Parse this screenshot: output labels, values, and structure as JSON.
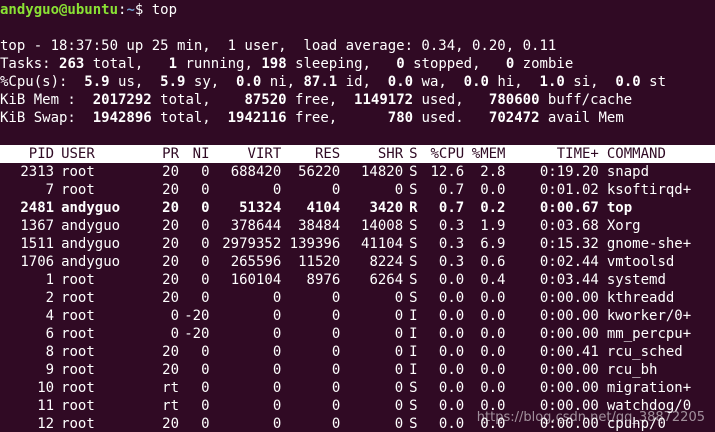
{
  "prompt": {
    "user_host": "andyguo@ubuntu",
    "sep": ":",
    "cwd": "~",
    "dollar": "$ ",
    "command": "top"
  },
  "summary": {
    "line1": "top - 18:37:50 up 25 min,  1 user,  load average: 0.34, 0.20, 0.11",
    "tasks": {
      "label": "Tasks: ",
      "total": "263",
      "total_lbl": " total,   ",
      "running": "1",
      "running_lbl": " running, ",
      "sleeping": "198",
      "sleeping_lbl": " sleeping,   ",
      "stopped": "0",
      "stopped_lbl": " stopped,   ",
      "zombie": "0",
      "zombie_lbl": " zombie"
    },
    "cpu": {
      "label": "%Cpu(s):  ",
      "us": "5.9",
      "us_lbl": " us,  ",
      "sy": "5.9",
      "sy_lbl": " sy,  ",
      "ni": "0.0",
      "ni_lbl": " ni, ",
      "id": "87.1",
      "id_lbl": " id,  ",
      "wa": "0.0",
      "wa_lbl": " wa,  ",
      "hi": "0.0",
      "hi_lbl": " hi,  ",
      "si": "1.0",
      "si_lbl": " si,  ",
      "st": "0.0",
      "st_lbl": " st"
    },
    "mem": {
      "label": "KiB Mem :  ",
      "total": "2017292",
      "total_lbl": " total,    ",
      "free": "87520",
      "free_lbl": " free,  ",
      "used": "1149172",
      "used_lbl": " used,   ",
      "cache": "780600",
      "cache_lbl": " buff/cache"
    },
    "swap": {
      "label": "KiB Swap:  ",
      "total": "1942896",
      "total_lbl": " total,  ",
      "free": "1942116",
      "free_lbl": " free,      ",
      "used": "780",
      "used_lbl": " used.   ",
      "avail": "702472",
      "avail_lbl": " avail Mem"
    }
  },
  "table": {
    "headers": [
      "PID",
      "USER",
      "PR",
      "NI",
      "VIRT",
      "RES",
      "SHR",
      "S",
      "%CPU",
      "%MEM",
      "TIME+",
      "COMMAND"
    ],
    "rows": [
      [
        "2313",
        "root",
        "20",
        "0",
        "688420",
        "56220",
        "14820",
        "S",
        "12.6",
        "2.8",
        "0:19.20",
        "snapd"
      ],
      [
        "7",
        "root",
        "20",
        "0",
        "0",
        "0",
        "0",
        "S",
        "0.7",
        "0.0",
        "0:01.02",
        "ksoftirqd+"
      ],
      [
        "2481",
        "andyguo",
        "20",
        "0",
        "51324",
        "4104",
        "3420",
        "R",
        "0.7",
        "0.2",
        "0:00.67",
        "top"
      ],
      [
        "1367",
        "andyguo",
        "20",
        "0",
        "378644",
        "38484",
        "14008",
        "S",
        "0.3",
        "1.9",
        "0:03.68",
        "Xorg"
      ],
      [
        "1511",
        "andyguo",
        "20",
        "0",
        "2979352",
        "139396",
        "41104",
        "S",
        "0.3",
        "6.9",
        "0:15.32",
        "gnome-she+"
      ],
      [
        "1706",
        "andyguo",
        "20",
        "0",
        "265596",
        "11520",
        "8224",
        "S",
        "0.3",
        "0.6",
        "0:02.44",
        "vmtoolsd"
      ],
      [
        "1",
        "root",
        "20",
        "0",
        "160104",
        "8976",
        "6264",
        "S",
        "0.0",
        "0.4",
        "0:03.44",
        "systemd"
      ],
      [
        "2",
        "root",
        "20",
        "0",
        "0",
        "0",
        "0",
        "S",
        "0.0",
        "0.0",
        "0:00.00",
        "kthreadd"
      ],
      [
        "4",
        "root",
        "0",
        "-20",
        "0",
        "0",
        "0",
        "I",
        "0.0",
        "0.0",
        "0:00.00",
        "kworker/0+"
      ],
      [
        "6",
        "root",
        "0",
        "-20",
        "0",
        "0",
        "0",
        "I",
        "0.0",
        "0.0",
        "0:00.00",
        "mm_percpu+"
      ],
      [
        "8",
        "root",
        "20",
        "0",
        "0",
        "0",
        "0",
        "I",
        "0.0",
        "0.0",
        "0:00.41",
        "rcu_sched"
      ],
      [
        "9",
        "root",
        "20",
        "0",
        "0",
        "0",
        "0",
        "I",
        "0.0",
        "0.0",
        "0:00.00",
        "rcu_bh"
      ],
      [
        "10",
        "root",
        "rt",
        "0",
        "0",
        "0",
        "0",
        "S",
        "0.0",
        "0.0",
        "0:00.00",
        "migration+"
      ],
      [
        "11",
        "root",
        "rt",
        "0",
        "0",
        "0",
        "0",
        "S",
        "0.0",
        "0.0",
        "0:00.00",
        "watchdog/0"
      ],
      [
        "12",
        "root",
        "20",
        "0",
        "0",
        "0",
        "0",
        "S",
        "0.0",
        "0.0",
        "0:00.00",
        "cpuhp/0"
      ]
    ]
  },
  "watermark": "https://blog.csdn.net/qq_38872205",
  "colors": {
    "background": "#300a24",
    "prompt_green": "#8ae234",
    "prompt_blue": "#729fcf",
    "header_bg": "#ffffff"
  }
}
